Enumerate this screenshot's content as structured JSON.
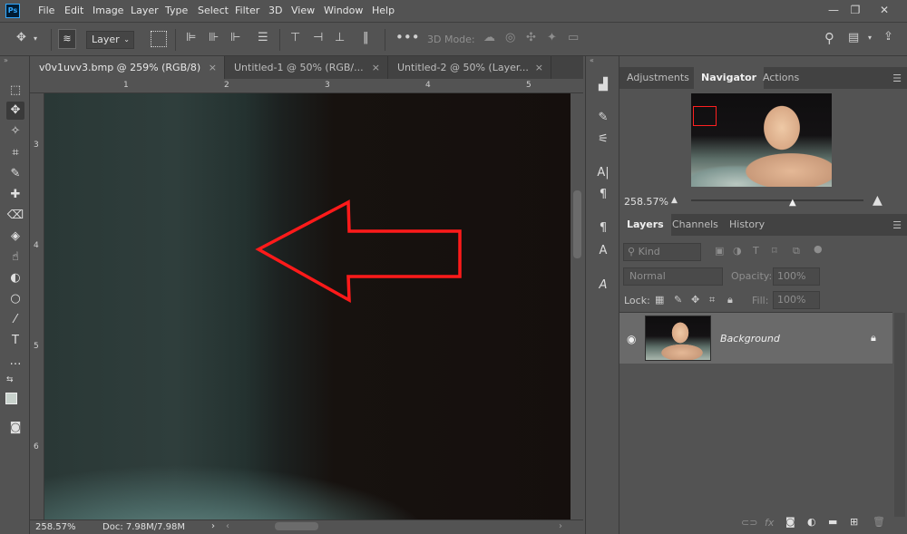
{
  "app": {
    "logo": "Ps"
  },
  "menu": [
    "File",
    "Edit",
    "Image",
    "Layer",
    "Type",
    "Select",
    "Filter",
    "3D",
    "View",
    "Window",
    "Help"
  ],
  "window_controls": {
    "minimize": "—",
    "restore": "❐",
    "close": "✕"
  },
  "options_bar": {
    "auto_select_value": "Layer",
    "mode_label": "3D Mode:"
  },
  "tabs": [
    {
      "label": "v0v1uvv3.bmp @ 259% (RGB/8)",
      "close": "×"
    },
    {
      "label": "Untitled-1 @ 50% (RGB/...",
      "close": "×"
    },
    {
      "label": "Untitled-2 @ 50% (Layer...",
      "close": "×"
    }
  ],
  "ruler": {
    "h_ticks": [
      "1",
      "2",
      "3",
      "4",
      "5"
    ],
    "v_ticks": [
      "3",
      "4",
      "5",
      "6"
    ]
  },
  "status": {
    "zoom": "258.57%",
    "doc": "Doc: 7.98M/7.98M",
    "arrow": "›"
  },
  "panels": {
    "top_tabs": [
      "Adjustments",
      "Navigator",
      "Actions"
    ],
    "navigator_zoom": "258.57%",
    "layer_tabs": [
      "Layers",
      "Channels",
      "History"
    ],
    "kind_label": "Kind",
    "blend_mode": "Normal",
    "opacity_label": "Opacity:",
    "opacity_value": "100%",
    "lock_label": "Lock:",
    "fill_label": "Fill:",
    "fill_value": "100%",
    "layer_name": "Background"
  },
  "annotation": {
    "color": "#ff1a1a",
    "shape": "arrow-left"
  },
  "colors": {
    "bg": "#535353",
    "panel_tab": "#424242",
    "accent_red": "#ff1a1a"
  }
}
